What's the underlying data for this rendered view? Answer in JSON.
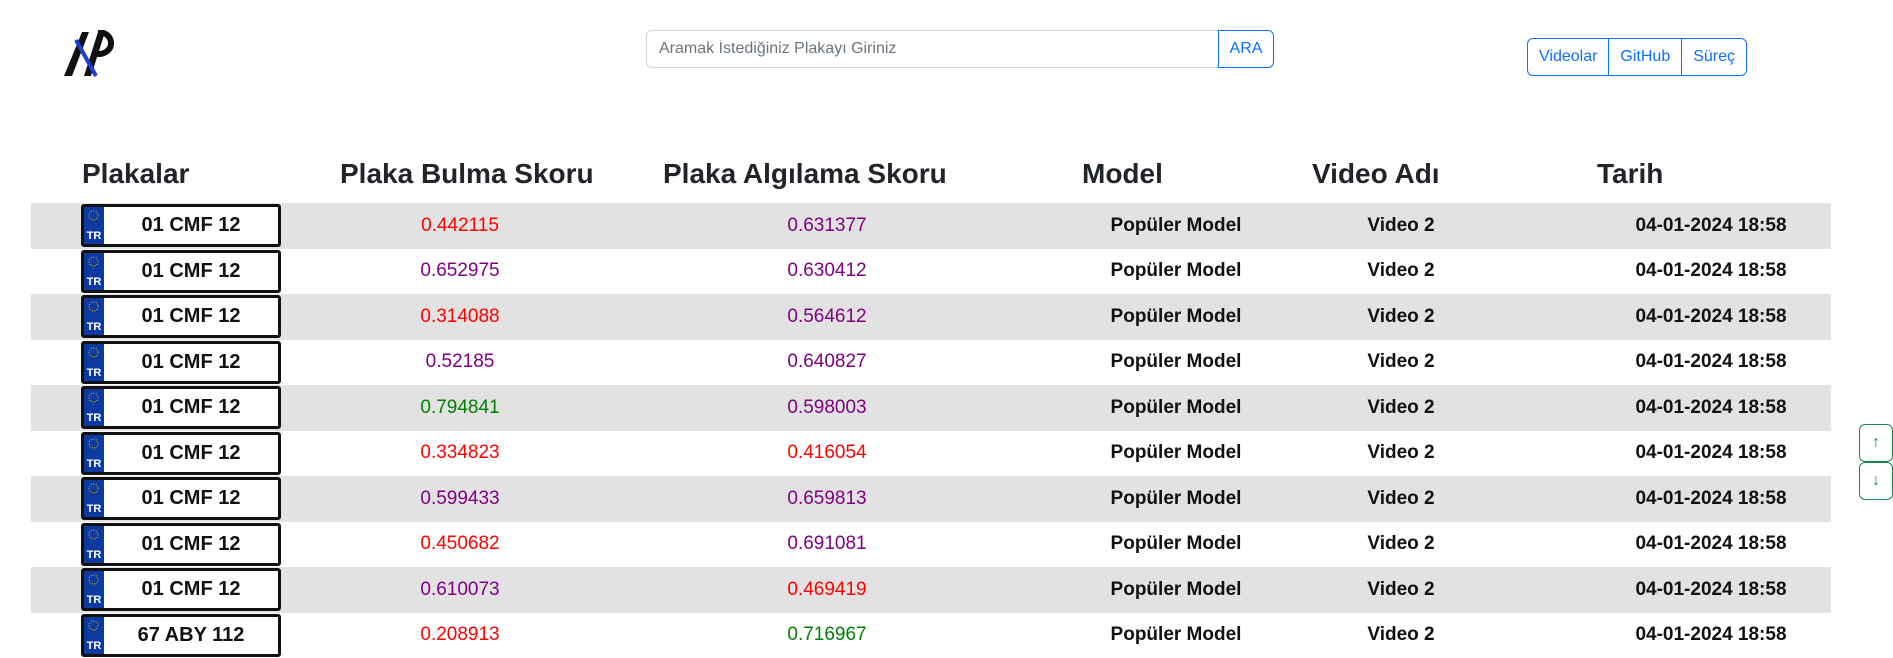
{
  "search": {
    "placeholder": "Aramak İstediğiniz Plakayı Giriniz",
    "button_label": "ARA"
  },
  "nav": [
    "Videolar",
    "GitHub",
    "Süreç"
  ],
  "table": {
    "headers": [
      "Plakalar",
      "Plaka Bulma Skoru",
      "Plaka Algılama Skoru",
      "Model",
      "Video Adı",
      "Tarih"
    ],
    "plate_country": "TR",
    "rows": [
      {
        "plate": "01 CMF 12",
        "find_score": "0.442115",
        "find_color": "#ff0000",
        "detect_score": "0.631377",
        "detect_color": "#800080",
        "model": "Popüler Model",
        "video": "Video 2",
        "date": "04-01-2024 18:58"
      },
      {
        "plate": "01 CMF 12",
        "find_score": "0.652975",
        "find_color": "#800080",
        "detect_score": "0.630412",
        "detect_color": "#800080",
        "model": "Popüler Model",
        "video": "Video 2",
        "date": "04-01-2024 18:58"
      },
      {
        "plate": "01 CMF 12",
        "find_score": "0.314088",
        "find_color": "#ff0000",
        "detect_score": "0.564612",
        "detect_color": "#800080",
        "model": "Popüler Model",
        "video": "Video 2",
        "date": "04-01-2024 18:58"
      },
      {
        "plate": "01 CMF 12",
        "find_score": "0.52185",
        "find_color": "#800080",
        "detect_score": "0.640827",
        "detect_color": "#800080",
        "model": "Popüler Model",
        "video": "Video 2",
        "date": "04-01-2024 18:58"
      },
      {
        "plate": "01 CMF 12",
        "find_score": "0.794841",
        "find_color": "#008000",
        "detect_score": "0.598003",
        "detect_color": "#800080",
        "model": "Popüler Model",
        "video": "Video 2",
        "date": "04-01-2024 18:58"
      },
      {
        "plate": "01 CMF 12",
        "find_score": "0.334823",
        "find_color": "#ff0000",
        "detect_score": "0.416054",
        "detect_color": "#ff0000",
        "model": "Popüler Model",
        "video": "Video 2",
        "date": "04-01-2024 18:58"
      },
      {
        "plate": "01 CMF 12",
        "find_score": "0.599433",
        "find_color": "#800080",
        "detect_score": "0.659813",
        "detect_color": "#800080",
        "model": "Popüler Model",
        "video": "Video 2",
        "date": "04-01-2024 18:58"
      },
      {
        "plate": "01 CMF 12",
        "find_score": "0.450682",
        "find_color": "#ff0000",
        "detect_score": "0.691081",
        "detect_color": "#800080",
        "model": "Popüler Model",
        "video": "Video 2",
        "date": "04-01-2024 18:58"
      },
      {
        "plate": "01 CMF 12",
        "find_score": "0.610073",
        "find_color": "#800080",
        "detect_score": "0.469419",
        "detect_color": "#ff0000",
        "model": "Popüler Model",
        "video": "Video 2",
        "date": "04-01-2024 18:58"
      },
      {
        "plate": "67 ABY 112",
        "find_score": "0.208913",
        "find_color": "#ff0000",
        "detect_score": "0.716967",
        "detect_color": "#008000",
        "model": "Popüler Model",
        "video": "Video 2",
        "date": "04-01-2024 18:58"
      }
    ]
  },
  "scroll": {
    "up": "↑",
    "down": "↓"
  },
  "colors": {
    "primary": "#0d6efd",
    "success": "#198754",
    "row_alt": "#e2e2e2",
    "plate_band": "#0c3aa0"
  }
}
